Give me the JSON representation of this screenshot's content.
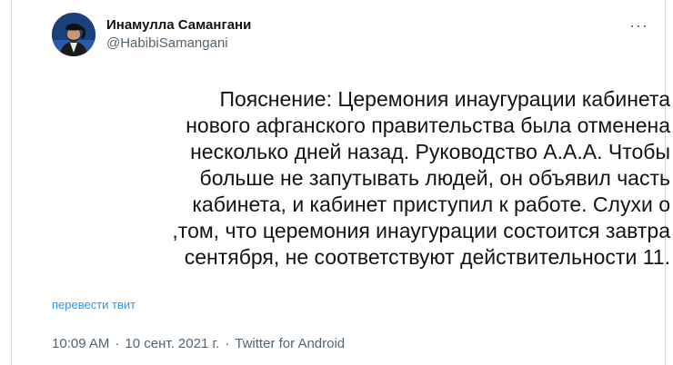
{
  "author": {
    "display_name": "Инамулла Самангани",
    "handle": "@HabibiSamangani"
  },
  "more_button": "···",
  "tweet": {
    "lines": [
      "Пояснение: Церемония инаугурации кабинета",
      "нового афганского правительства была отменена",
      "несколько дней назад. Руководство А.А.А. Чтобы",
      "больше не запутывать людей, он объявил часть",
      "кабинета, и кабинет приступил к работе. Слухи о",
      "том, что церемония инаугурации состоится завтра,",
      ".11 сентября, не соответствуют действительности"
    ]
  },
  "translate_link": "перевести твит",
  "meta": {
    "time": "10:09 AM",
    "date": "10 сент. 2021 г.",
    "separator": "·",
    "source": "Twitter for Android"
  },
  "colors": {
    "text": "#0f1419",
    "secondary": "#536471",
    "link": "#1d9bf0",
    "border": "#cfd9de"
  }
}
